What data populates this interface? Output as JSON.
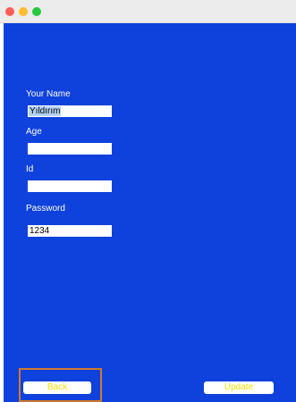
{
  "window": {
    "controls": [
      "close",
      "minimize",
      "zoom"
    ]
  },
  "colors": {
    "panel_background": "#0f41dc",
    "button_text": "#f3e200",
    "focus_outline": "#d07a2c",
    "selection": "#b3d2f7"
  },
  "form": {
    "name": {
      "label": "Your Name",
      "value": "Yıldırım"
    },
    "age": {
      "label": "Age",
      "value": ""
    },
    "id": {
      "label": "Id",
      "value": ""
    },
    "password": {
      "label": "Password",
      "value": "1234"
    }
  },
  "buttons": {
    "back": "Back",
    "update": "Update"
  }
}
